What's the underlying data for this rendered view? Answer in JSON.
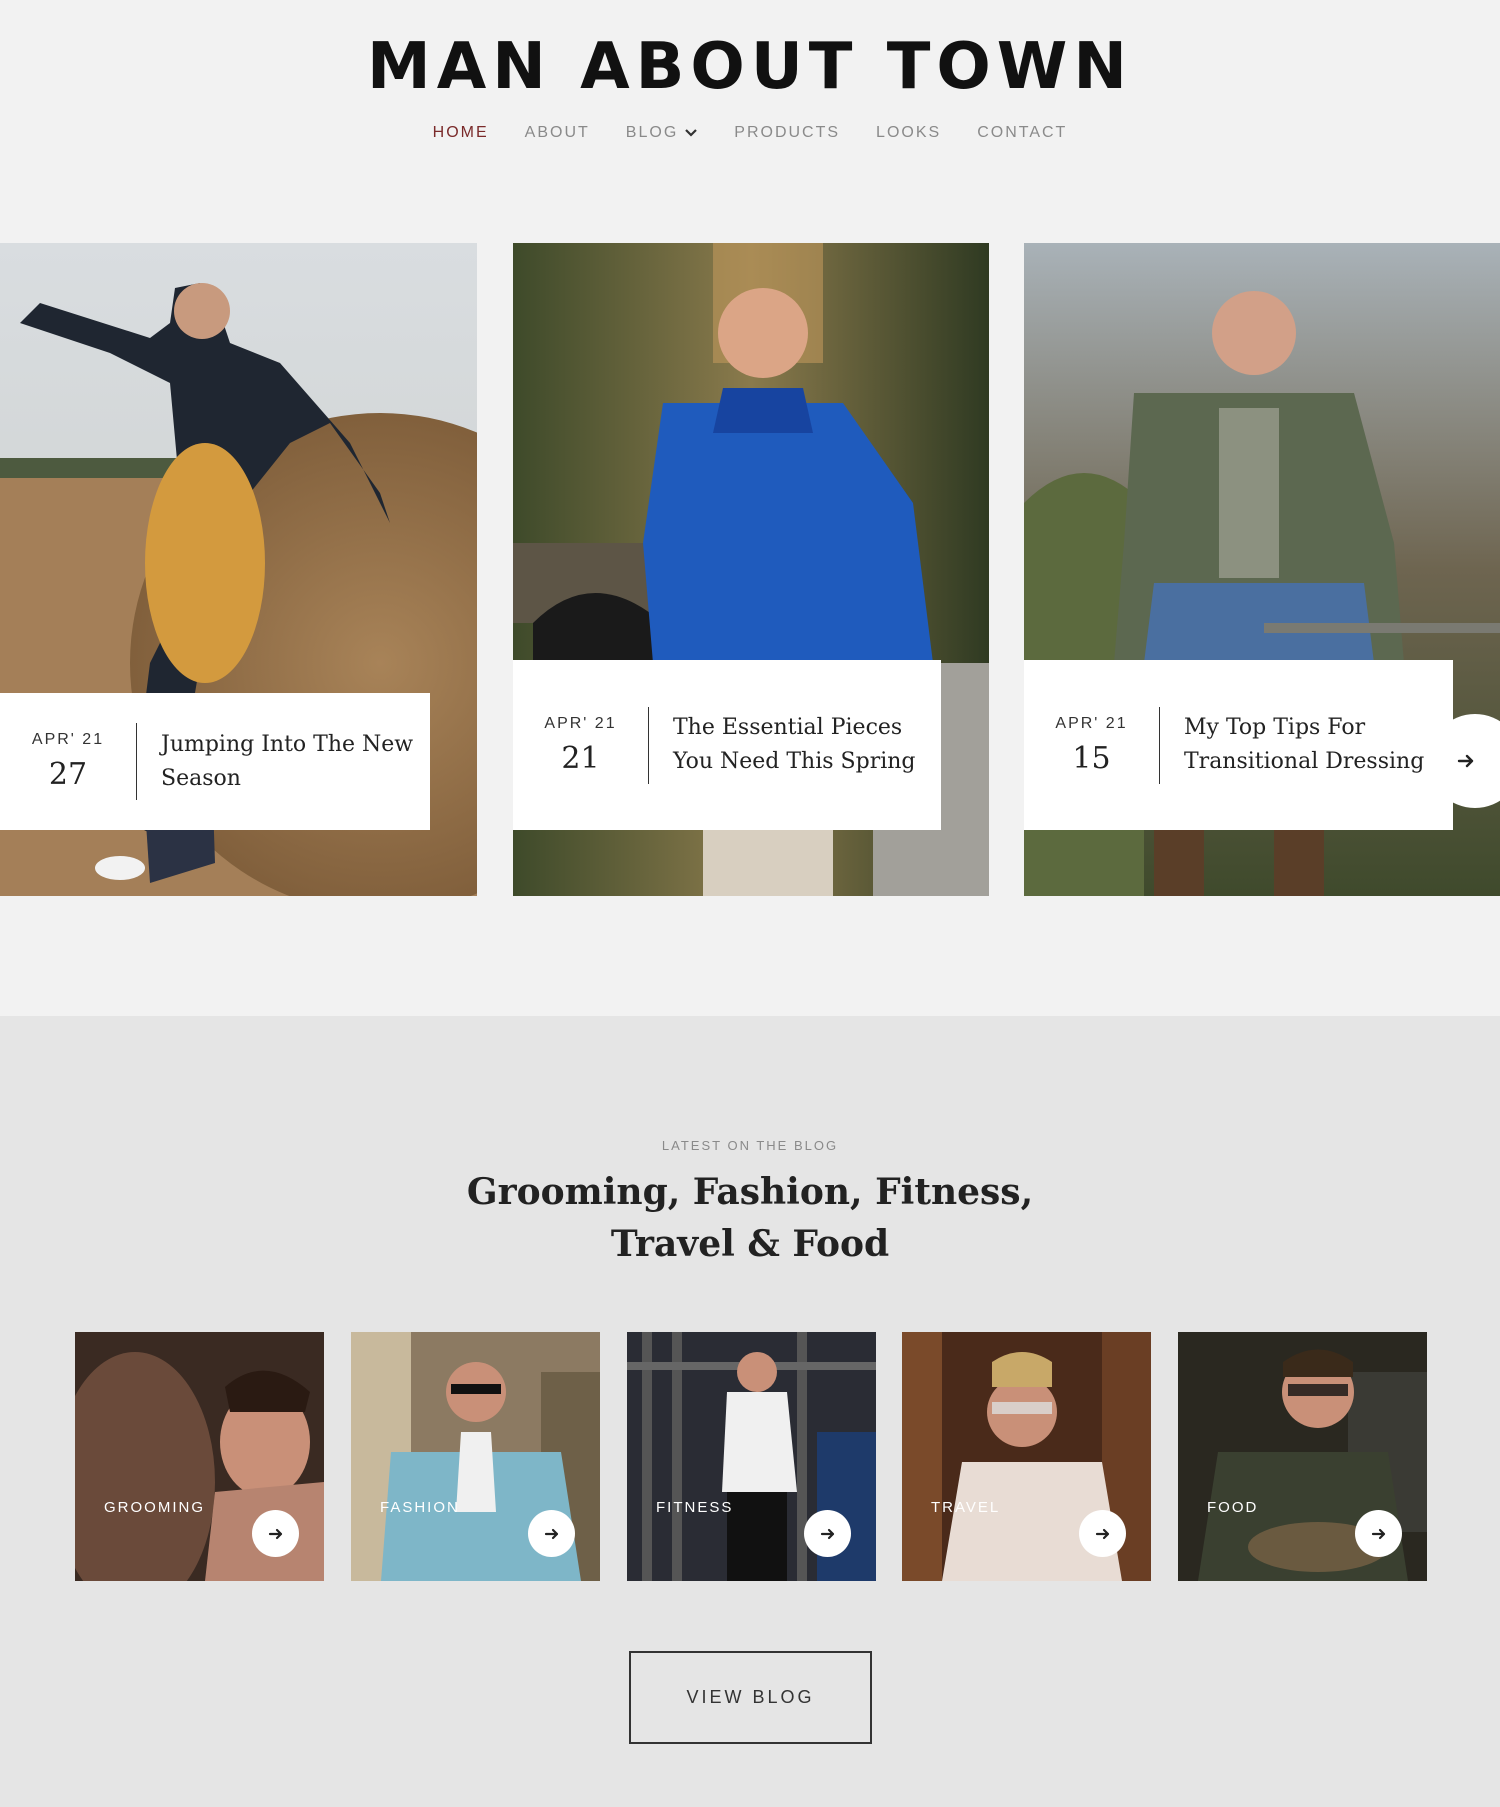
{
  "header": {
    "site_title": "MAN ABOUT TOWN",
    "nav": [
      {
        "label": "HOME",
        "active": true
      },
      {
        "label": "ABOUT"
      },
      {
        "label": "BLOG",
        "has_dropdown": true
      },
      {
        "label": "PRODUCTS"
      },
      {
        "label": "LOOKS"
      },
      {
        "label": "CONTACT"
      }
    ]
  },
  "featured_posts": [
    {
      "month": "APR' 21",
      "day": "27",
      "title": "Jumping Into The New Season"
    },
    {
      "month": "APR' 21",
      "day": "21",
      "title": "The Essential Pieces You Need This Spring"
    },
    {
      "month": "APR' 21",
      "day": "15",
      "title": "My Top Tips For Transitional Dressing"
    }
  ],
  "slider": {
    "next_icon": "arrow-right-icon"
  },
  "blog_section": {
    "kicker": "LATEST ON THE BLOG",
    "heading_line1": "Grooming, Fashion, Fitness,",
    "heading_line2": "Travel & Food",
    "categories": [
      {
        "label": "GROOMING"
      },
      {
        "label": "FASHION"
      },
      {
        "label": "FITNESS"
      },
      {
        "label": "TRAVEL"
      },
      {
        "label": "FOOD"
      }
    ],
    "view_blog_label": "VIEW BLOG"
  },
  "colors": {
    "accent_active_nav": "#7a2a2a",
    "page_bg": "#f2f2f2",
    "blog_bg": "#e5e5e5",
    "card_bg": "#ffffff"
  }
}
